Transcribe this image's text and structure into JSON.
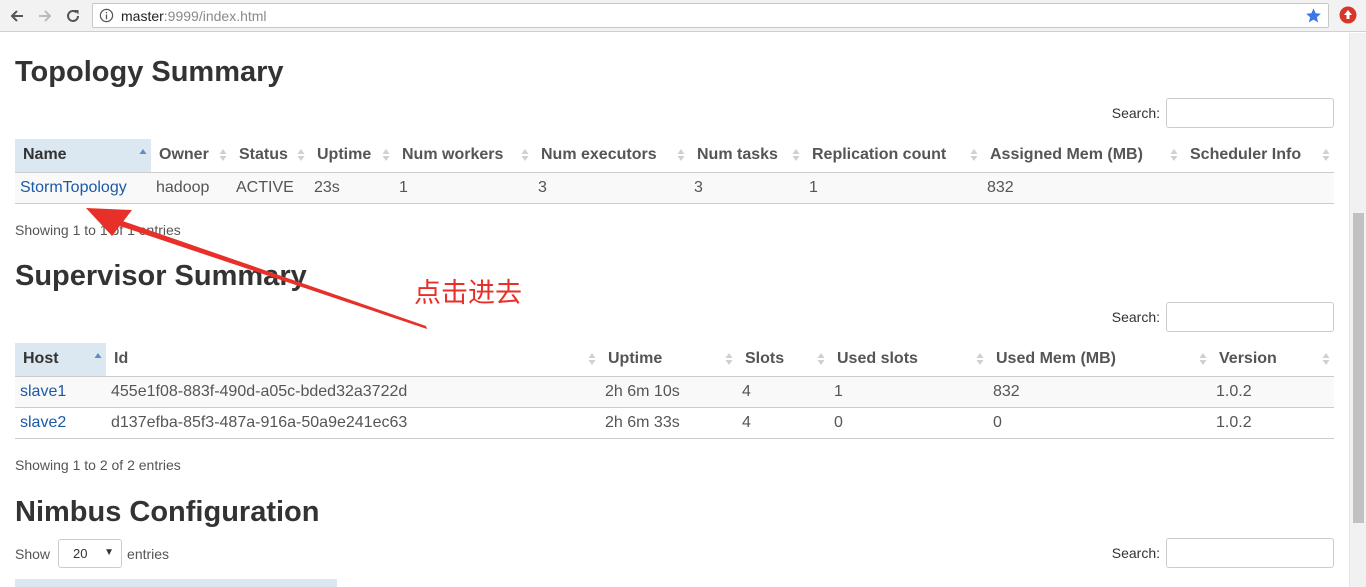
{
  "browser": {
    "url_host": "master",
    "url_rest": ":9999/index.html"
  },
  "topology": {
    "title": "Topology Summary",
    "search_label": "Search:",
    "columns": [
      "Name",
      "Owner",
      "Status",
      "Uptime",
      "Num workers",
      "Num executors",
      "Num tasks",
      "Replication count",
      "Assigned Mem (MB)",
      "Scheduler Info"
    ],
    "rows": [
      [
        "StormTopology",
        "hadoop",
        "ACTIVE",
        "23s",
        "1",
        "3",
        "3",
        "1",
        "832",
        ""
      ]
    ],
    "info": "Showing 1 to 1 of 1 entries"
  },
  "supervisor": {
    "title": "Supervisor Summary",
    "search_label": "Search:",
    "columns": [
      "Host",
      "Id",
      "Uptime",
      "Slots",
      "Used slots",
      "Used Mem (MB)",
      "Version"
    ],
    "rows": [
      [
        "slave1",
        "455e1f08-883f-490d-a05c-bded32a3722d",
        "2h 6m 10s",
        "4",
        "1",
        "832",
        "1.0.2"
      ],
      [
        "slave2",
        "d137efba-85f3-487a-916a-50a9e241ec63",
        "2h 6m 33s",
        "4",
        "0",
        "0",
        "1.0.2"
      ]
    ],
    "info": "Showing 1 to 2 of 2 entries"
  },
  "nimbus": {
    "title": "Nimbus Configuration",
    "show_label": "Show",
    "page_length": "20",
    "entries_label": "entries",
    "search_label": "Search:"
  },
  "annotation": {
    "text": "点击进去",
    "color": "#e8302a"
  },
  "colors": {
    "link": "#1a5aa8",
    "sorted_header": "#dbe8f1"
  }
}
